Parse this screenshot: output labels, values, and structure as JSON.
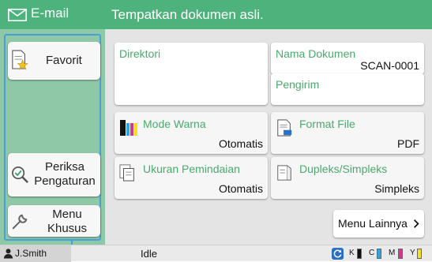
{
  "app": {
    "title": "E-mail",
    "icon": "envelope-icon"
  },
  "header": {
    "message": "Tempatkan dokumen asli."
  },
  "sidebar": {
    "favorites_label": "Favorit",
    "check_settings_label": "Periksa Pengaturan",
    "custom_menu_label": "Menu Khusus"
  },
  "main": {
    "directory": {
      "label": "Direktori"
    },
    "document_name": {
      "label": "Nama Dokumen",
      "value": "SCAN-0001"
    },
    "sender": {
      "label": "Pengirim"
    },
    "color_mode": {
      "label": "Mode Warna",
      "value": "Otomatis"
    },
    "file_format": {
      "label": "Format File",
      "value": "PDF"
    },
    "scan_size": {
      "label": "Ukuran Pemindaian",
      "value": "Otomatis"
    },
    "duplex": {
      "label": "Dupleks/Simpleks",
      "value": "Simpleks"
    },
    "more_menu": {
      "label": "Menu Lainnya"
    }
  },
  "status_bar": {
    "user": "J.Smith",
    "status": "Idle",
    "toner": [
      {
        "label": "K",
        "color": "#111111"
      },
      {
        "label": "C",
        "color": "#2aa7e0"
      },
      {
        "label": "M",
        "color": "#d8358f"
      },
      {
        "label": "Y",
        "color": "#f3e21c"
      }
    ]
  },
  "colors": {
    "header_green": "#4eb27c",
    "panel_green": "#8fc8a6",
    "label_green": "#4aa96e",
    "focus_blue": "#4a9fd8"
  }
}
